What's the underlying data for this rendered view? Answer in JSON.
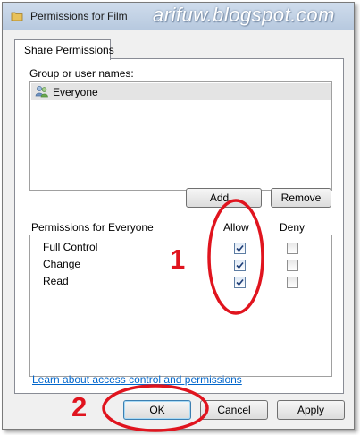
{
  "window": {
    "title": "Permissions for Film"
  },
  "watermark": "arifuw.blogspot.com",
  "tabs": [
    {
      "label": "Share Permissions"
    }
  ],
  "group": {
    "label": "Group or user names:",
    "users": [
      {
        "name": "Everyone"
      }
    ],
    "add_label": "Add...",
    "remove_label": "Remove"
  },
  "permissions": {
    "header": "Permissions for Everyone",
    "allow_label": "Allow",
    "deny_label": "Deny",
    "rows": [
      {
        "name": "Full Control",
        "allow": true,
        "deny": false
      },
      {
        "name": "Change",
        "allow": true,
        "deny": false
      },
      {
        "name": "Read",
        "allow": true,
        "deny": false
      }
    ]
  },
  "link_text": "Learn about access control and permissions",
  "buttons": {
    "ok": "OK",
    "cancel": "Cancel",
    "apply": "Apply"
  },
  "annotations": {
    "step1": "1",
    "step2": "2",
    "color": "#e0141e"
  },
  "icons": {
    "title": "folder-icon",
    "user": "users-group-icon",
    "check": "checkmark-icon"
  }
}
